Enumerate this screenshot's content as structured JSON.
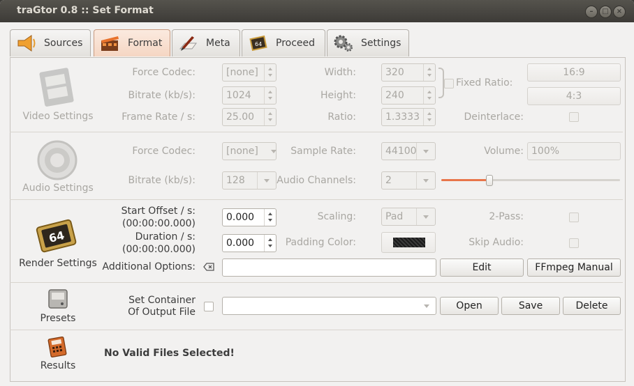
{
  "window": {
    "title": "traGtor 0.8 :: Set Format"
  },
  "tabs": [
    {
      "label": "Sources"
    },
    {
      "label": "Format"
    },
    {
      "label": "Meta"
    },
    {
      "label": "Proceed"
    },
    {
      "label": "Settings"
    }
  ],
  "video": {
    "section_label": "Video Settings",
    "force_codec_label": "Force Codec:",
    "force_codec_value": "[none]",
    "bitrate_label": "Bitrate (kb/s):",
    "bitrate_value": "1024",
    "framerate_label": "Frame Rate / s:",
    "framerate_value": "25.00",
    "width_label": "Width:",
    "width_value": "320",
    "height_label": "Height:",
    "height_value": "240",
    "ratio_label": "Ratio:",
    "ratio_value": "1.3333",
    "fixed_ratio_label": "Fixed Ratio:",
    "preset_169": "16:9",
    "preset_43": "4:3",
    "deinterlace_label": "Deinterlace:"
  },
  "audio": {
    "section_label": "Audio Settings",
    "force_codec_label": "Force Codec:",
    "force_codec_value": "[none]",
    "bitrate_label": "Bitrate (kb/s):",
    "bitrate_value": "128",
    "sample_rate_label": "Sample Rate:",
    "sample_rate_value": "44100",
    "channels_label": "Audio Channels:",
    "channels_value": "2",
    "volume_label": "Volume:",
    "volume_value": "100%",
    "volume_slider_fraction": 0.27
  },
  "render": {
    "section_label": "Render Settings",
    "start_offset_label": "Start Offset / s:",
    "start_offset_time": "(00:00:00.000)",
    "start_offset_value": "0.000",
    "duration_label": "Duration / s:",
    "duration_time": "(00:00:00.000)",
    "duration_value": "0.000",
    "scaling_label": "Scaling:",
    "scaling_value": "Pad",
    "padding_color_label": "Padding Color:",
    "two_pass_label": "2-Pass:",
    "skip_audio_label": "Skip Audio:",
    "additional_options_label": "Additional Options:",
    "additional_options_value": "",
    "edit_label": "Edit",
    "ffmpeg_manual_label": "FFmpeg Manual"
  },
  "presets": {
    "section_label": "Presets",
    "set_container_line1": "Set Container",
    "set_container_line2": "Of Output File",
    "preset_value": "",
    "open_label": "Open",
    "save_label": "Save",
    "delete_label": "Delete"
  },
  "results": {
    "section_label": "Results",
    "message": "No Valid Files Selected!"
  }
}
